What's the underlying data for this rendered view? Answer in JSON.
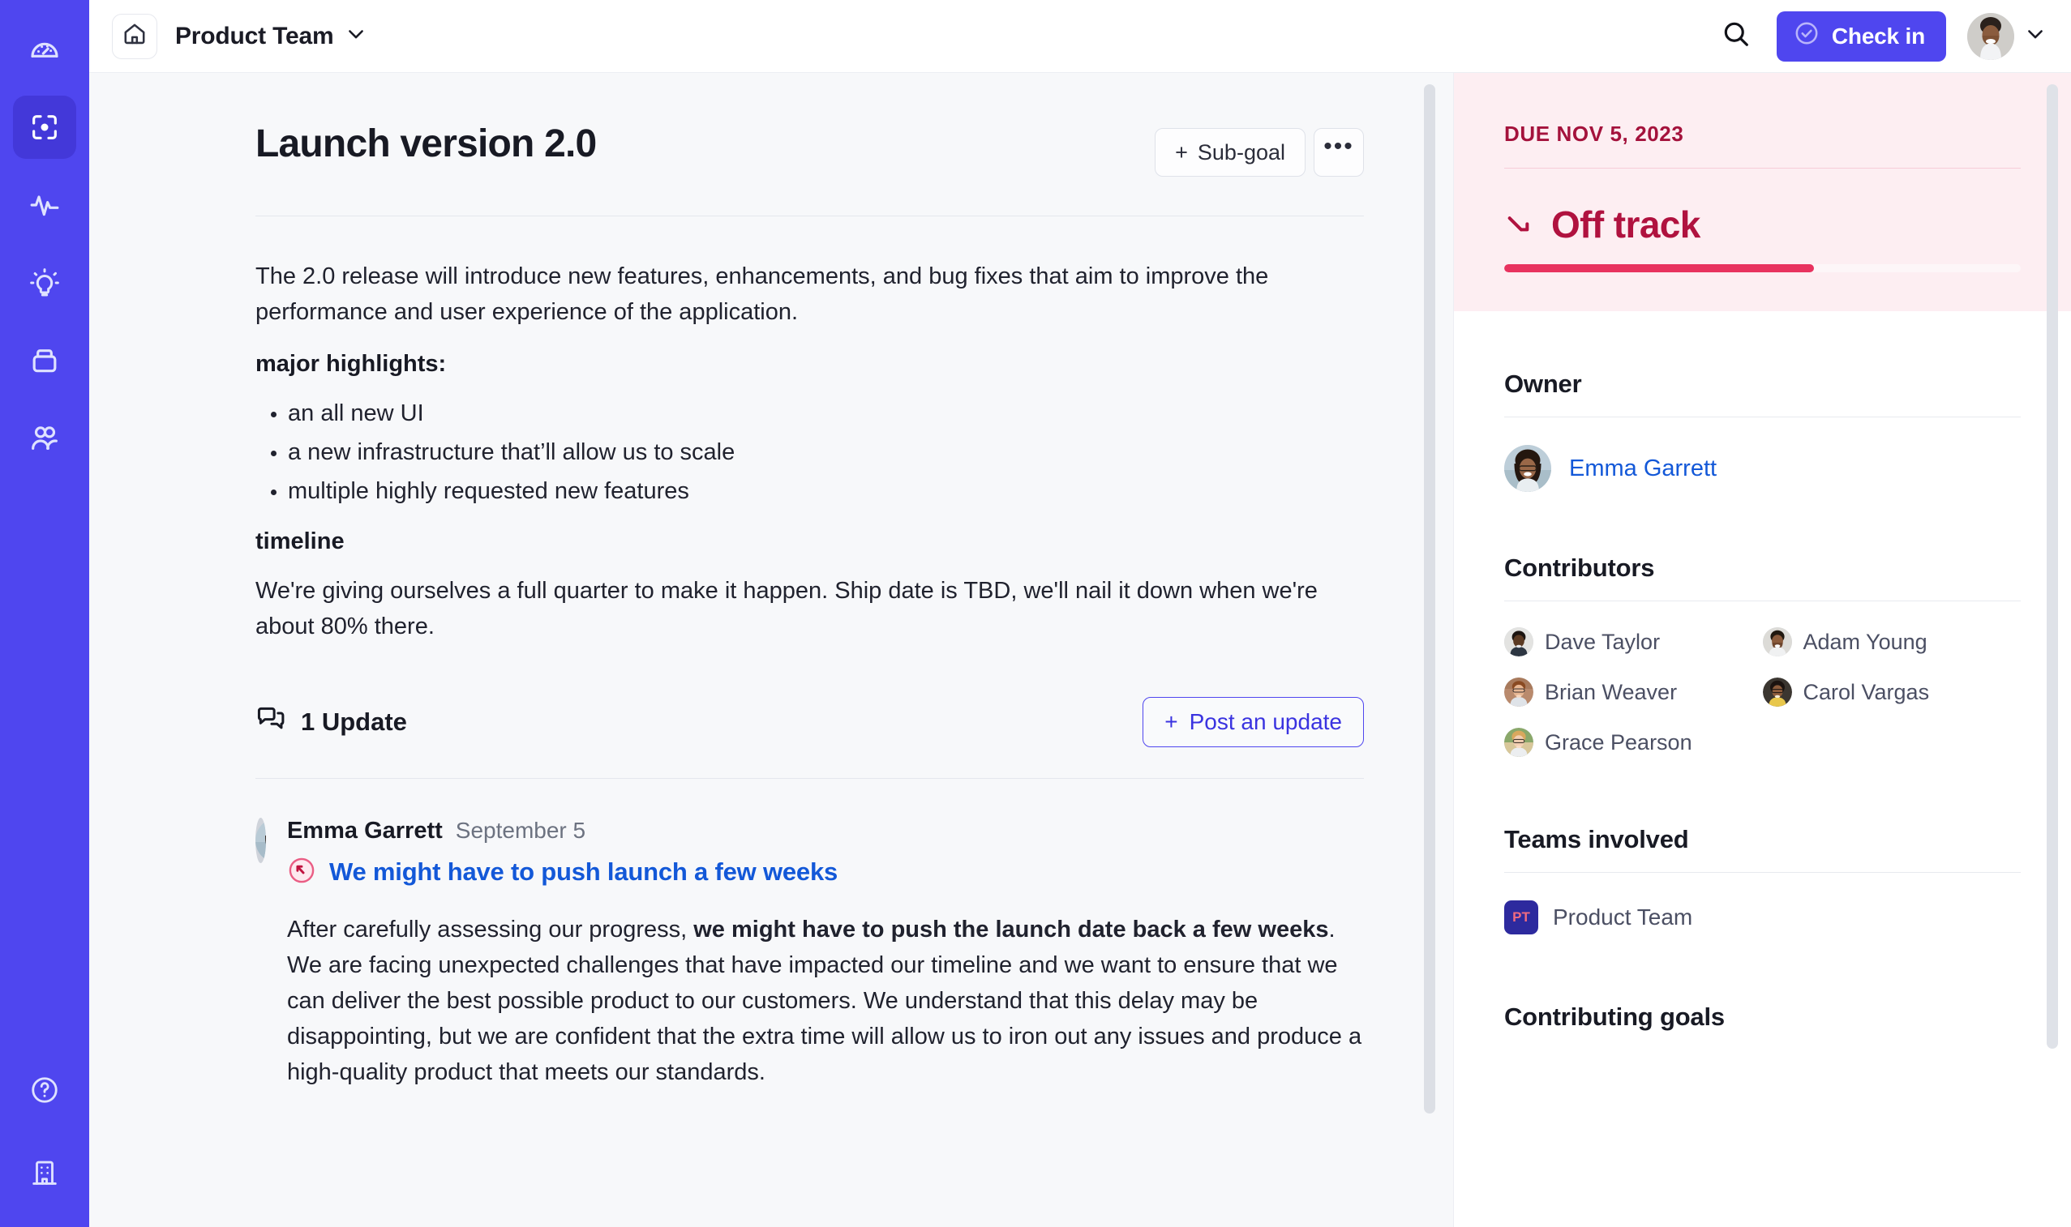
{
  "sidebar": {
    "items": [
      {
        "icon": "dashboard-gauge-icon",
        "active": false
      },
      {
        "icon": "target-focus-icon",
        "active": true
      },
      {
        "icon": "activity-pulse-icon",
        "active": false
      },
      {
        "icon": "lightbulb-icon",
        "active": false
      },
      {
        "icon": "package-box-icon",
        "active": false
      },
      {
        "icon": "users-icon",
        "active": false
      }
    ],
    "bottom": [
      {
        "icon": "help-circle-icon"
      },
      {
        "icon": "building-icon"
      }
    ]
  },
  "header": {
    "home_icon": "home-icon",
    "workspace_name": "Product Team",
    "workspace_chevron": "chevron-down-icon",
    "search_icon": "search-icon",
    "checkin_label": "Check in",
    "checkin_icon": "check-circle-icon",
    "avatar_chevron": "chevron-down-icon"
  },
  "goal": {
    "title": "Launch version 2.0",
    "subgoal_label": "Sub-goal",
    "subgoal_plus": "+",
    "more_label": "•••",
    "description": {
      "intro": "The 2.0 release will introduce new features, enhancements, and bug fixes that aim to improve the performance and user experience of the application.",
      "highlights_label": "major highlights:",
      "highlights": [
        "an all new UI",
        "a new infrastructure that’ll allow us to scale",
        "multiple highly requested new features"
      ],
      "timeline_label": "timeline",
      "timeline_text": "We're giving ourselves a full quarter to make it happen. Ship date is TBD, we'll nail it down when we're about 80% there."
    }
  },
  "updates": {
    "count_label": "1 Update",
    "count_icon": "comments-icon",
    "post_label": "Post an update",
    "post_plus": "+",
    "items": [
      {
        "author": "Emma Garrett",
        "date": "September 5",
        "status_icon": "off-track-arrow-icon",
        "title": "We might have to push launch a few weeks",
        "body_part1": "After carefully assessing our progress, ",
        "body_bold": "we might have to push the launch date back a few weeks",
        "body_part2": ". We are facing unexpected challenges that have impacted our timeline and we want to ensure that we can deliver the best possible product to our customers. We understand that this delay may be disappointing, but we are confident that the extra time will allow us to iron out any issues and produce a high-quality product that meets our standards."
      }
    ]
  },
  "side": {
    "due_label": "DUE NOV 5, 2023",
    "status_label": "Off track",
    "status_icon": "trend-down-arrow-icon",
    "progress_percent": 60,
    "owner_heading": "Owner",
    "owner_name": "Emma Garrett",
    "contributors_heading": "Contributors",
    "contributors": [
      "Dave Taylor",
      "Adam Young",
      "Brian Weaver",
      "Carol Vargas",
      "Grace Pearson"
    ],
    "teams_heading": "Teams involved",
    "team_badge_initials": "PT",
    "team_name": "Product Team",
    "goals_heading": "Contributing goals"
  },
  "colors": {
    "brand": "#4f46ef",
    "status_red": "#b0123f",
    "status_bg": "#fdeef2",
    "progress_fill": "#e8325f",
    "link_blue": "#1358d8"
  }
}
